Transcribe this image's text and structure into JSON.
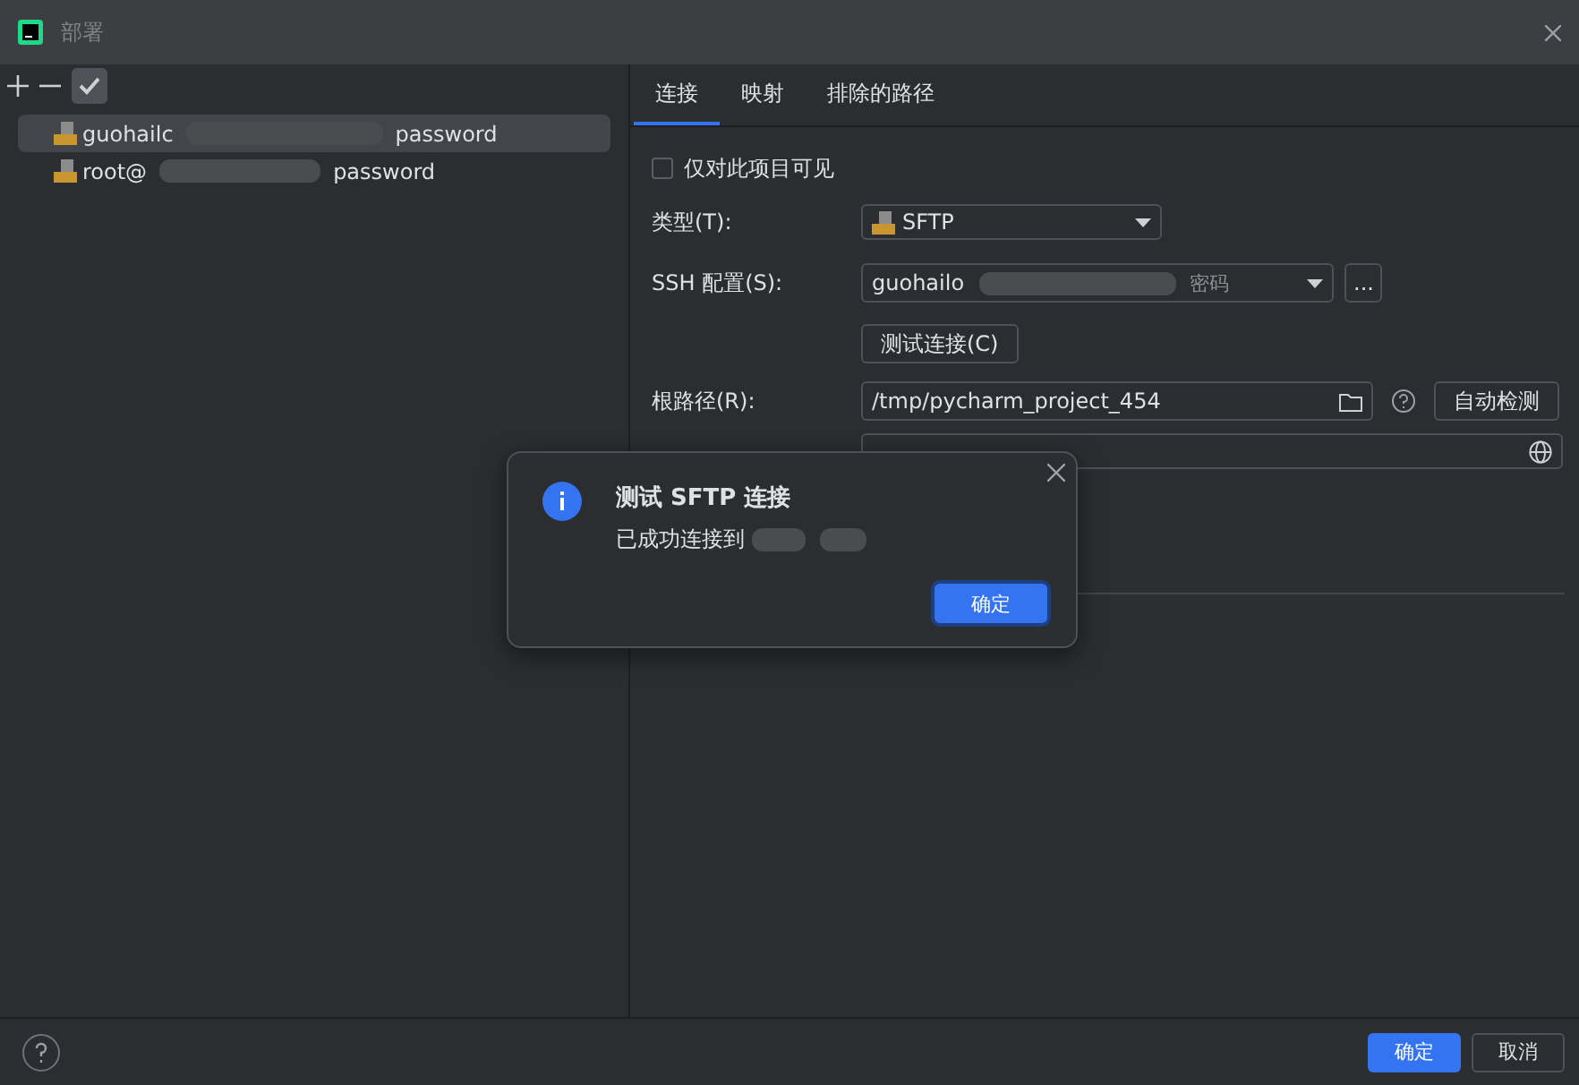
{
  "window": {
    "title": "部署"
  },
  "servers": [
    {
      "name": "guohailc",
      "suffix": "password",
      "selected": true
    },
    {
      "name": "root@",
      "suffix": "password",
      "selected": false
    }
  ],
  "tabs": [
    {
      "label": "连接",
      "selected": true
    },
    {
      "label": "映射",
      "selected": false
    },
    {
      "label": "排除的路径",
      "selected": false
    }
  ],
  "form": {
    "visible_only": {
      "label": "仅对此项目可见",
      "checked": false
    },
    "type": {
      "label": "类型(T):",
      "value": "SFTP"
    },
    "ssh": {
      "label": "SSH 配置(S):",
      "value": "guohailo",
      "suffix": "密码",
      "more": "..."
    },
    "test_button": "测试连接(C)",
    "root_path": {
      "label": "根路径(R):",
      "value": "/tmp/pycharm_project_454",
      "auto_button": "自动检测"
    }
  },
  "dialog": {
    "title": "测试 SFTP 连接",
    "message": "已成功连接到",
    "ok": "确定"
  },
  "footer": {
    "buttons": [
      {
        "label": "确定",
        "primary": true
      },
      {
        "label": "取消",
        "primary": false
      }
    ]
  }
}
